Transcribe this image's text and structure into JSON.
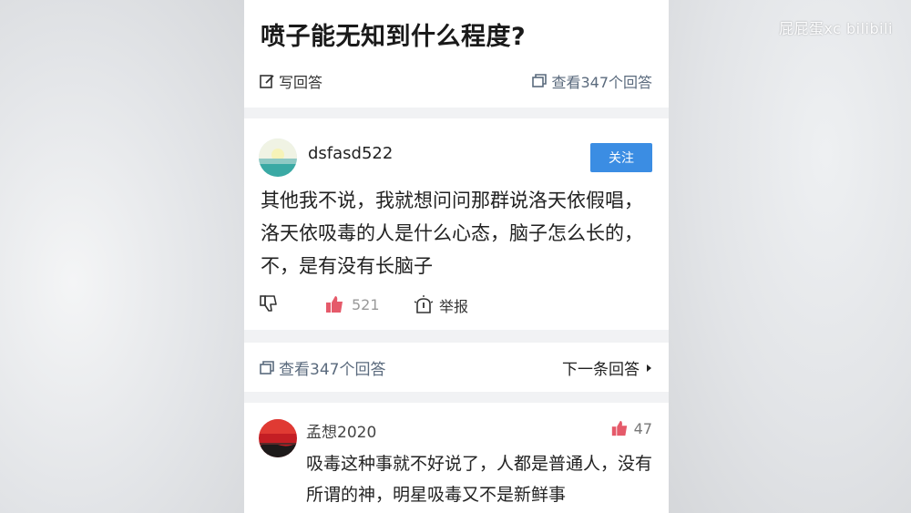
{
  "watermark": "屁屁蛋xc bilibili",
  "question": {
    "title": "喷子能无知到什么程度?",
    "write_label": "写回答",
    "view_label": "查看347个回答"
  },
  "answer": {
    "username": "dsfasd522",
    "follow_label": "关注",
    "content": "其他我不说，我就想问问那群说洛天依假唱，洛天依吸毒的人是什么心态，脑子怎么长的，不，是有没有长脑子",
    "like_count": "521",
    "report_label": "举报"
  },
  "nav_bar": {
    "view_label": "查看347个回答",
    "next_label": "下一条回答"
  },
  "comment": {
    "username": "孟想2020",
    "like_count": "47",
    "content": "吸毒这种事就不好说了，人都是普通人，没有所谓的神，明星吸毒又不是新鲜事"
  },
  "colors": {
    "follow_button": "#3b8de3",
    "like_icon": "#e55a6a",
    "link_gray": "#5a6a7d"
  }
}
